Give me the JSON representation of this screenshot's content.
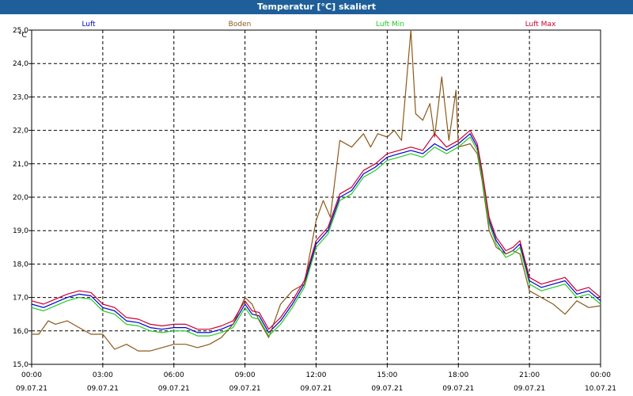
{
  "window": {
    "title": "Temperatur [°C] skaliert"
  },
  "chart_data": {
    "type": "line",
    "title": "Temperatur [°C] skaliert",
    "ylabel": "°C",
    "xlabel": "",
    "xlim": [
      0,
      24
    ],
    "ylim": [
      15.0,
      25.0
    ],
    "yticks": [
      "15,0",
      "16,0",
      "17,0",
      "18,0",
      "19,0",
      "20,0",
      "21,0",
      "22,0",
      "23,0",
      "24,0",
      "25,0"
    ],
    "xticks": [
      {
        "h": 0,
        "time": "00:00",
        "date": "09.07.21"
      },
      {
        "h": 3,
        "time": "03:00",
        "date": "09.07.21"
      },
      {
        "h": 6,
        "time": "06:00",
        "date": "09.07.21"
      },
      {
        "h": 9,
        "time": "09:00",
        "date": "09.07.21"
      },
      {
        "h": 12,
        "time": "12:00",
        "date": "09.07.21"
      },
      {
        "h": 15,
        "time": "15:00",
        "date": "09.07.21"
      },
      {
        "h": 18,
        "time": "18:00",
        "date": "09.07.21"
      },
      {
        "h": 21,
        "time": "21:00",
        "date": "09.07.21"
      },
      {
        "h": 24,
        "time": "00:00",
        "date": "10.07.21"
      }
    ],
    "grid": true,
    "legend_placement": "top",
    "series": [
      {
        "name": "Luft",
        "color": "#0000cc",
        "points": [
          [
            0,
            16.8
          ],
          [
            0.5,
            16.7
          ],
          [
            1,
            16.85
          ],
          [
            1.5,
            17.0
          ],
          [
            2,
            17.1
          ],
          [
            2.5,
            17.05
          ],
          [
            3,
            16.7
          ],
          [
            3.5,
            16.6
          ],
          [
            4,
            16.3
          ],
          [
            4.5,
            16.25
          ],
          [
            5,
            16.1
          ],
          [
            5.5,
            16.05
          ],
          [
            6,
            16.1
          ],
          [
            6.5,
            16.1
          ],
          [
            7,
            15.95
          ],
          [
            7.5,
            15.95
          ],
          [
            8,
            16.05
          ],
          [
            8.5,
            16.2
          ],
          [
            9,
            16.8
          ],
          [
            9.3,
            16.5
          ],
          [
            9.6,
            16.45
          ],
          [
            10,
            15.95
          ],
          [
            10.5,
            16.3
          ],
          [
            11,
            16.8
          ],
          [
            11.5,
            17.4
          ],
          [
            12,
            18.6
          ],
          [
            12.5,
            19.0
          ],
          [
            13,
            20.0
          ],
          [
            13.5,
            20.2
          ],
          [
            14,
            20.7
          ],
          [
            14.5,
            20.9
          ],
          [
            15,
            21.2
          ],
          [
            15.5,
            21.3
          ],
          [
            16,
            21.4
          ],
          [
            16.5,
            21.3
          ],
          [
            17,
            21.6
          ],
          [
            17.5,
            21.4
          ],
          [
            18,
            21.6
          ],
          [
            18.5,
            21.9
          ],
          [
            18.8,
            21.5
          ],
          [
            19,
            20.7
          ],
          [
            19.3,
            19.3
          ],
          [
            19.6,
            18.7
          ],
          [
            20,
            18.3
          ],
          [
            20.3,
            18.4
          ],
          [
            20.6,
            18.6
          ],
          [
            21,
            17.5
          ],
          [
            21.5,
            17.3
          ],
          [
            22,
            17.4
          ],
          [
            22.5,
            17.5
          ],
          [
            23,
            17.1
          ],
          [
            23.5,
            17.2
          ],
          [
            24,
            16.9
          ]
        ]
      },
      {
        "name": "Boden",
        "color": "#8b5a1a",
        "points": [
          [
            0,
            15.9
          ],
          [
            0.3,
            15.9
          ],
          [
            0.7,
            16.3
          ],
          [
            1,
            16.2
          ],
          [
            1.5,
            16.3
          ],
          [
            2,
            16.1
          ],
          [
            2.5,
            15.9
          ],
          [
            3,
            15.9
          ],
          [
            3.5,
            15.45
          ],
          [
            4,
            15.6
          ],
          [
            4.5,
            15.4
          ],
          [
            5,
            15.4
          ],
          [
            5.5,
            15.5
          ],
          [
            6,
            15.6
          ],
          [
            6.5,
            15.6
          ],
          [
            7,
            15.5
          ],
          [
            7.5,
            15.6
          ],
          [
            8,
            15.8
          ],
          [
            8.5,
            16.2
          ],
          [
            9,
            17.0
          ],
          [
            9.3,
            16.8
          ],
          [
            9.6,
            16.3
          ],
          [
            10,
            15.8
          ],
          [
            10.5,
            16.8
          ],
          [
            11,
            17.2
          ],
          [
            11.5,
            17.4
          ],
          [
            12,
            19.3
          ],
          [
            12.3,
            19.9
          ],
          [
            12.6,
            19.4
          ],
          [
            13,
            21.7
          ],
          [
            13.5,
            21.5
          ],
          [
            14,
            21.9
          ],
          [
            14.3,
            21.5
          ],
          [
            14.6,
            21.9
          ],
          [
            15,
            21.8
          ],
          [
            15.3,
            22.0
          ],
          [
            15.6,
            21.7
          ],
          [
            16,
            25.0
          ],
          [
            16.2,
            22.5
          ],
          [
            16.5,
            22.3
          ],
          [
            16.8,
            22.8
          ],
          [
            17,
            21.8
          ],
          [
            17.3,
            23.6
          ],
          [
            17.6,
            21.7
          ],
          [
            17.9,
            23.2
          ],
          [
            18,
            21.5
          ],
          [
            18.5,
            21.6
          ],
          [
            18.8,
            21.3
          ],
          [
            19,
            20.5
          ],
          [
            19.3,
            19.0
          ],
          [
            19.6,
            18.5
          ],
          [
            20,
            18.3
          ],
          [
            20.3,
            18.4
          ],
          [
            20.6,
            18.3
          ],
          [
            21,
            17.2
          ],
          [
            21.5,
            17.0
          ],
          [
            22,
            16.8
          ],
          [
            22.5,
            16.5
          ],
          [
            23,
            16.9
          ],
          [
            23.5,
            16.7
          ],
          [
            24,
            16.75
          ]
        ]
      },
      {
        "name": "Luft Min",
        "color": "#22cc22",
        "points": [
          [
            0,
            16.7
          ],
          [
            0.5,
            16.6
          ],
          [
            1,
            16.75
          ],
          [
            1.5,
            16.9
          ],
          [
            2,
            17.0
          ],
          [
            2.5,
            16.95
          ],
          [
            3,
            16.6
          ],
          [
            3.5,
            16.5
          ],
          [
            4,
            16.2
          ],
          [
            4.5,
            16.15
          ],
          [
            5,
            16.0
          ],
          [
            5.5,
            15.95
          ],
          [
            6,
            16.0
          ],
          [
            6.5,
            16.0
          ],
          [
            7,
            15.85
          ],
          [
            7.5,
            15.85
          ],
          [
            8,
            15.95
          ],
          [
            8.5,
            16.1
          ],
          [
            9,
            16.7
          ],
          [
            9.3,
            16.4
          ],
          [
            9.6,
            16.35
          ],
          [
            10,
            15.85
          ],
          [
            10.5,
            16.2
          ],
          [
            11,
            16.7
          ],
          [
            11.5,
            17.3
          ],
          [
            12,
            18.5
          ],
          [
            12.5,
            18.9
          ],
          [
            13,
            19.9
          ],
          [
            13.5,
            20.1
          ],
          [
            14,
            20.6
          ],
          [
            14.5,
            20.8
          ],
          [
            15,
            21.1
          ],
          [
            15.5,
            21.2
          ],
          [
            16,
            21.3
          ],
          [
            16.5,
            21.2
          ],
          [
            17,
            21.5
          ],
          [
            17.5,
            21.3
          ],
          [
            18,
            21.5
          ],
          [
            18.5,
            21.8
          ],
          [
            18.8,
            21.4
          ],
          [
            19,
            20.6
          ],
          [
            19.3,
            19.2
          ],
          [
            19.6,
            18.6
          ],
          [
            20,
            18.2
          ],
          [
            20.3,
            18.3
          ],
          [
            20.6,
            18.5
          ],
          [
            21,
            17.4
          ],
          [
            21.5,
            17.2
          ],
          [
            22,
            17.3
          ],
          [
            22.5,
            17.4
          ],
          [
            23,
            17.0
          ],
          [
            23.5,
            17.1
          ],
          [
            24,
            16.8
          ]
        ]
      },
      {
        "name": "Luft Max",
        "color": "#cc0033",
        "points": [
          [
            0,
            16.9
          ],
          [
            0.5,
            16.8
          ],
          [
            1,
            16.95
          ],
          [
            1.5,
            17.1
          ],
          [
            2,
            17.2
          ],
          [
            2.5,
            17.15
          ],
          [
            3,
            16.8
          ],
          [
            3.5,
            16.7
          ],
          [
            4,
            16.4
          ],
          [
            4.5,
            16.35
          ],
          [
            5,
            16.2
          ],
          [
            5.5,
            16.15
          ],
          [
            6,
            16.2
          ],
          [
            6.5,
            16.2
          ],
          [
            7,
            16.05
          ],
          [
            7.5,
            16.05
          ],
          [
            8,
            16.15
          ],
          [
            8.5,
            16.3
          ],
          [
            9,
            16.9
          ],
          [
            9.3,
            16.6
          ],
          [
            9.6,
            16.55
          ],
          [
            10,
            16.05
          ],
          [
            10.5,
            16.4
          ],
          [
            11,
            16.9
          ],
          [
            11.5,
            17.5
          ],
          [
            12,
            18.7
          ],
          [
            12.5,
            19.1
          ],
          [
            13,
            20.1
          ],
          [
            13.5,
            20.3
          ],
          [
            14,
            20.8
          ],
          [
            14.5,
            21.0
          ],
          [
            15,
            21.3
          ],
          [
            15.5,
            21.4
          ],
          [
            16,
            21.5
          ],
          [
            16.5,
            21.4
          ],
          [
            17,
            21.9
          ],
          [
            17.5,
            21.5
          ],
          [
            18,
            21.7
          ],
          [
            18.5,
            22.0
          ],
          [
            18.8,
            21.6
          ],
          [
            19,
            20.8
          ],
          [
            19.3,
            19.4
          ],
          [
            19.6,
            18.8
          ],
          [
            20,
            18.4
          ],
          [
            20.3,
            18.5
          ],
          [
            20.6,
            18.7
          ],
          [
            21,
            17.6
          ],
          [
            21.5,
            17.4
          ],
          [
            22,
            17.5
          ],
          [
            22.5,
            17.6
          ],
          [
            23,
            17.2
          ],
          [
            23.5,
            17.3
          ],
          [
            24,
            17.0
          ]
        ]
      }
    ]
  }
}
